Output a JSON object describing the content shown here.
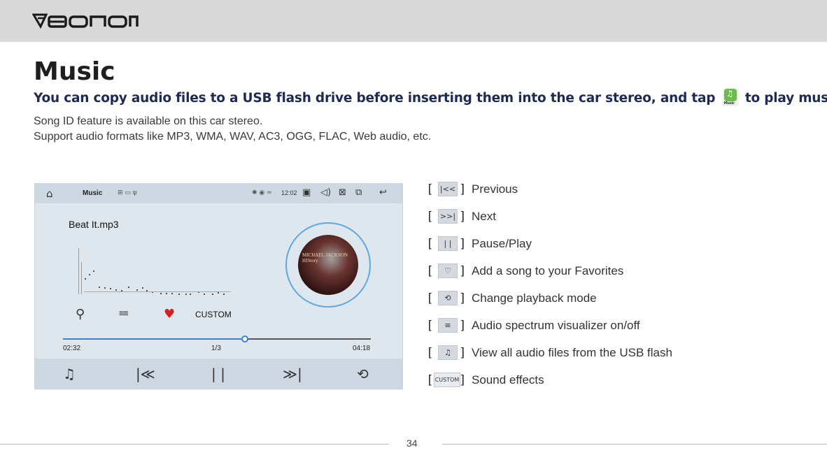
{
  "header": {
    "brand": "EONON"
  },
  "page": {
    "title": "Music",
    "subtitle_before": "You can copy audio files to a USB flash drive before inserting them into the car stereo, and tap",
    "subtitle_after": "to play music.",
    "app_icon_caption": "Music",
    "desc_line1": "Song ID feature is available on this car stereo.",
    "desc_line2": "Support audio formats like MP3, WMA, WAV, AC3, OGG, FLAC, Web audio, etc.",
    "page_number": "34"
  },
  "screen": {
    "status_title": "Music",
    "time": "12:02",
    "song": "Beat It.mp3",
    "album_text": "MICHAEL JACKSON HIStory",
    "custom_label": "CUSTOM",
    "current_time": "02:32",
    "track_index": "1/3",
    "total_time": "04:18",
    "progress_fraction": 0.59
  },
  "legend": [
    {
      "icon": "previous-icon",
      "glyph": "|<<",
      "label": "Previous"
    },
    {
      "icon": "next-icon",
      "glyph": ">>|",
      "label": "Next"
    },
    {
      "icon": "pause-play-icon",
      "glyph": "| |",
      "label": "Pause/Play"
    },
    {
      "icon": "heart-outline-icon",
      "glyph": "♡",
      "label": "Add a song to your Favorites"
    },
    {
      "icon": "repeat-icon",
      "glyph": "⟲",
      "label": "Change playback mode"
    },
    {
      "icon": "spectrum-icon",
      "glyph": "≡",
      "label": "Audio spectrum visualizer on/off"
    },
    {
      "icon": "file-list-icon",
      "glyph": "♫",
      "label": "View all audio files from the USB flash"
    },
    {
      "icon": "custom-icon",
      "glyph": "CUSTOM",
      "label": "Sound effects"
    }
  ],
  "colors": {
    "accent": "#3b82d4",
    "heart": "#d0202a",
    "subtitle": "#1e2a52"
  }
}
